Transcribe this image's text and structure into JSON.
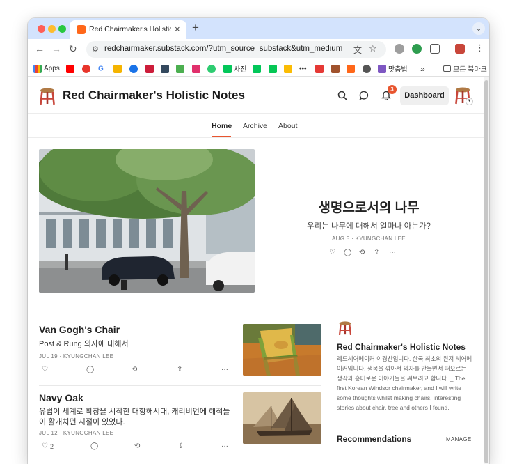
{
  "browser": {
    "tab_title": "Red Chairmaker's Holistic Notes",
    "tab_close": "×",
    "new_tab": "+",
    "url": "redchairmaker.substack.com/?utm_source=substack&utm_medium=web...",
    "bookmarks": [
      {
        "label": "Apps",
        "color": "#4285f4"
      },
      {
        "label": "",
        "color": "#ff0000"
      },
      {
        "label": "",
        "color": "#e8352b"
      },
      {
        "label": "G",
        "color": "#4285f4"
      },
      {
        "label": "",
        "color": "#f5b400"
      },
      {
        "label": "",
        "color": "#1a73e8"
      },
      {
        "label": "",
        "color": "#cc1d3a"
      },
      {
        "label": "",
        "color": "#34495e"
      },
      {
        "label": "",
        "color": "#4caf50"
      },
      {
        "label": "",
        "color": "#e1306c"
      },
      {
        "label": "",
        "color": "#2ecc71"
      },
      {
        "label": "사전",
        "color": "#03c75a"
      },
      {
        "label": "",
        "color": "#03c75a"
      },
      {
        "label": "",
        "color": "#06c755"
      },
      {
        "label": "",
        "color": "#fbbc04"
      },
      {
        "label": "",
        "color": "#222222"
      },
      {
        "label": "",
        "color": "#e53935"
      },
      {
        "label": "",
        "color": "#a0522d"
      },
      {
        "label": "",
        "color": "#ff6719"
      },
      {
        "label": "",
        "color": "#555555"
      },
      {
        "label": "맞춤법",
        "color": "#7e57c2"
      }
    ],
    "more_bookmarks": "»",
    "all_bookmarks": "모든 북마크"
  },
  "site": {
    "title": "Red Chairmaker's Holistic Notes",
    "notification_count": "3",
    "dashboard_label": "Dashboard",
    "nav": [
      "Home",
      "Archive",
      "About"
    ],
    "accent": "#e8552f"
  },
  "hero": {
    "title": "생명으로서의 나무",
    "subtitle": "우리는 나무에 대해서 얼마나 아는가?",
    "meta": "AUG 5 · KYUNGCHAN LEE",
    "more": "···"
  },
  "posts": [
    {
      "title": "Van Gogh's Chair",
      "subtitle": "Post & Rung 의자에 대해서",
      "meta": "JUL 19 · KYUNGCHAN LEE",
      "likes": "",
      "more": "···"
    },
    {
      "title": "Navy Oak",
      "subtitle": "유럽이 세계로 확장을 시작한 대항해시대, 캐리비언에 해적들이 활개치던 시절이 있었다.",
      "meta": "JUL 12 · KYUNGCHAN LEE",
      "likes": "2",
      "more": "···"
    }
  ],
  "sidebar": {
    "title": "Red Chairmaker's Holistic Notes",
    "description": "레드체어메이커 이경찬입니다. 한국 최초의 윈저 체어메이커입니다. 생목을 깎아서 의자를 만들면서 떠오르는 생각과 흥미로운 이야기들을 써보려고 합니다. _ The first Korean Windsor chairmaker, and I will write some thoughts whilst making chairs, interesting stories about chair, tree and others I found.",
    "recommendations_title": "Recommendations",
    "manage_label": "MANAGE"
  }
}
